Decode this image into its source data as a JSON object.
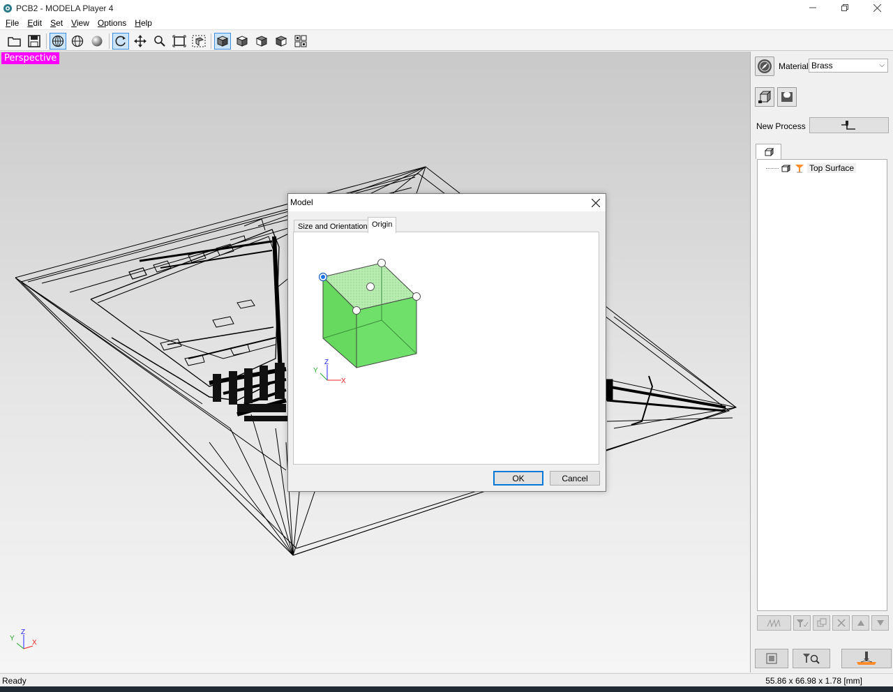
{
  "window": {
    "title": "PCB2 - MODELA Player 4"
  },
  "menu": [
    {
      "label": "File",
      "accel": "F",
      "rest": "ile"
    },
    {
      "label": "Edit",
      "accel": "E",
      "rest": "dit"
    },
    {
      "label": "Set",
      "accel": "S",
      "rest": "et"
    },
    {
      "label": "View",
      "accel": "V",
      "rest": "iew"
    },
    {
      "label": "Options",
      "accel": "O",
      "rest": "ptions"
    },
    {
      "label": "Help",
      "accel": "H",
      "rest": "elp"
    }
  ],
  "toolbar": {
    "icons": [
      "open-folder-icon",
      "save-icon",
      "wireframe-view-icon",
      "surface-view-icon",
      "shaded-sphere-icon",
      "rotate-icon",
      "pan-icon",
      "zoom-icon",
      "fit-all-icon",
      "zoom-window-icon",
      "perspective-view-icon",
      "top-view-icon",
      "front-view-icon",
      "right-view-icon",
      "four-view-icon"
    ]
  },
  "viewport": {
    "view_label": "Perspective",
    "axis": {
      "x": "X",
      "y": "Y",
      "z": "Z"
    }
  },
  "right_panel": {
    "material_label": "Material",
    "material_value": "Brass",
    "new_process_label": "New Process",
    "tree_items": [
      {
        "label": "Top Surface"
      }
    ]
  },
  "dialog": {
    "title": "Model",
    "tabs": [
      {
        "label": "Size and Orientation",
        "active": false
      },
      {
        "label": "Origin",
        "active": true
      }
    ],
    "origin_axis": {
      "x": "X",
      "y": "Y",
      "z": "Z"
    },
    "ok_label": "OK",
    "cancel_label": "Cancel"
  },
  "status": {
    "left": "Ready",
    "right": "55.86 x 66.98 x 1.78 [mm]"
  }
}
